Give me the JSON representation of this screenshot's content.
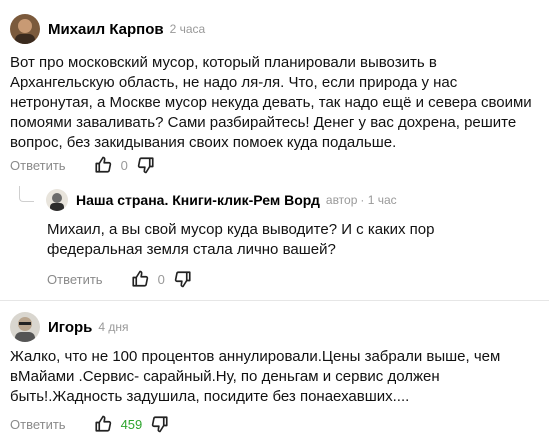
{
  "comments": [
    {
      "author": "Михаил Карпов",
      "time": "2 часа",
      "text": "Вот про московский мусор, который планировали вывозить в Архангельскую область, не надо ля-ля. Что, если природа у нас нетронутая, а Москве мусор некуда девать, так надо ещё и севера своими помоями заваливать? Сами разбирайтесь! Денег у вас дохрена, решите вопрос, без закидывания своих помоек куда подальше.",
      "reply_label": "Ответить",
      "likes": "0"
    },
    {
      "author": "Наша страна. Книги-клик-Рем Ворд",
      "badge": "автор",
      "time": "· 1 час",
      "text": "Михаил, а вы свой мусор куда выводите? И с каких пор федеральная земля стала лично вашей?",
      "reply_label": "Ответить",
      "likes": "0"
    },
    {
      "author": "Игорь",
      "time": "4 дня",
      "text": "Жалко, что не 100 процентов аннулировали.Цены забрали выше, чем вМайами .Сервис- сарайный.Ну, по деньгам и сервис должен быть!.Жадность задушила, посидите без понаехавших....",
      "reply_label": "Ответить",
      "likes": "459"
    }
  ],
  "colors": {
    "likes_positive": "#2ea52e",
    "muted": "#999999"
  },
  "icons": [
    "thumbs-up-icon",
    "thumbs-down-icon"
  ]
}
